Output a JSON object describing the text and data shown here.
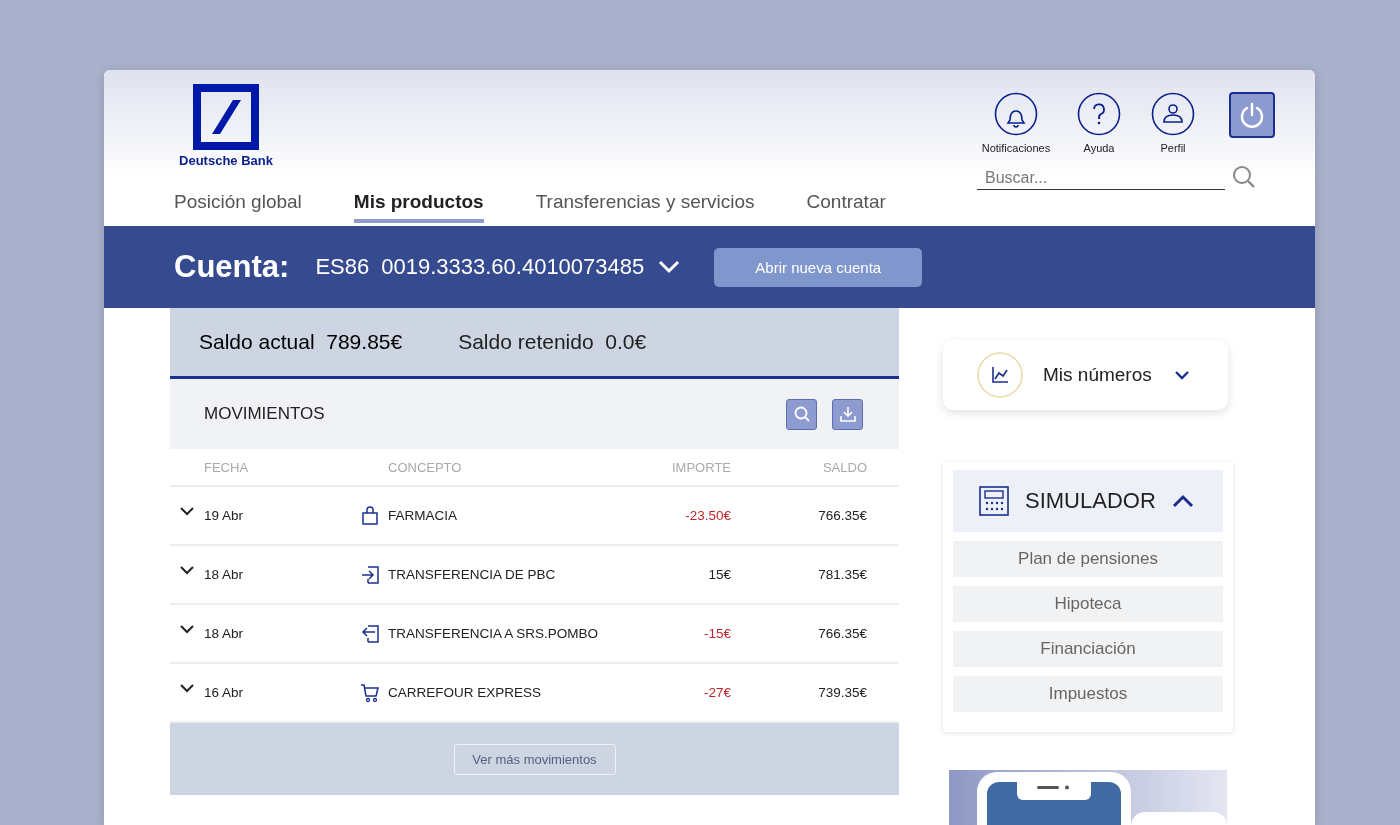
{
  "logo": {
    "text": "Deutsche Bank"
  },
  "header_actions": [
    {
      "kind": "bell",
      "label": "Notificaciones"
    },
    {
      "kind": "help",
      "label": "Ayuda"
    },
    {
      "kind": "user",
      "label": "Perfil"
    },
    {
      "kind": "power"
    }
  ],
  "nav_tabs": [
    {
      "label": "Posición global",
      "selected": false
    },
    {
      "label": "Mis productos",
      "selected": true
    },
    {
      "label": "Transferencias y servicios",
      "selected": false
    },
    {
      "label": "Contratar",
      "selected": false
    }
  ],
  "search": {
    "placeholder": "Buscar..."
  },
  "account_bar": {
    "title": "Cuenta:",
    "prefix": "ES86",
    "number": "0019.3333.60.4010073485",
    "button": "Abrir nueva cuenta"
  },
  "balances": [
    {
      "label": "Saldo actual",
      "value": "789.85€",
      "emphasis": true
    },
    {
      "label": "Saldo retenido",
      "value": "0.0€",
      "emphasis": false
    }
  ],
  "movements": {
    "title": "MOVIMIENTOS",
    "columns": [
      "FECHA",
      "CONCEPTO",
      "IMPORTE",
      "SALDO"
    ],
    "rows": [
      {
        "kind": "bag",
        "date": "19 Abr",
        "concept": "FARMACIA",
        "amount": "-23.50€",
        "debit": true,
        "balance": "766.35€",
        "expanded": false
      },
      {
        "kind": "transfer_in",
        "date": "18 Abr",
        "concept": "TRANSFERENCIA DE PBC",
        "amount": "15€",
        "debit": false,
        "balance": "781.35€",
        "expanded": false
      },
      {
        "kind": "transfer_out",
        "date": "18 Abr",
        "concept": "TRANSFERENCIA A SRS.POMBO",
        "amount": "-15€",
        "debit": true,
        "balance": "766.35€",
        "expanded": false
      },
      {
        "kind": "cart",
        "date": "16 Abr",
        "concept": "CARREFOUR EXPRESS",
        "amount": "-27€",
        "debit": true,
        "balance": "739.35€",
        "expanded": false
      }
    ],
    "more_button": "Ver más movimientos"
  },
  "my_numbers": {
    "label": "Mis números",
    "expanded": false
  },
  "simulator": {
    "title": "SIMULADOR",
    "expanded": true,
    "items": [
      "Plan de pensiones",
      "Hipoteca",
      "Financiación",
      "Impuestos"
    ]
  }
}
